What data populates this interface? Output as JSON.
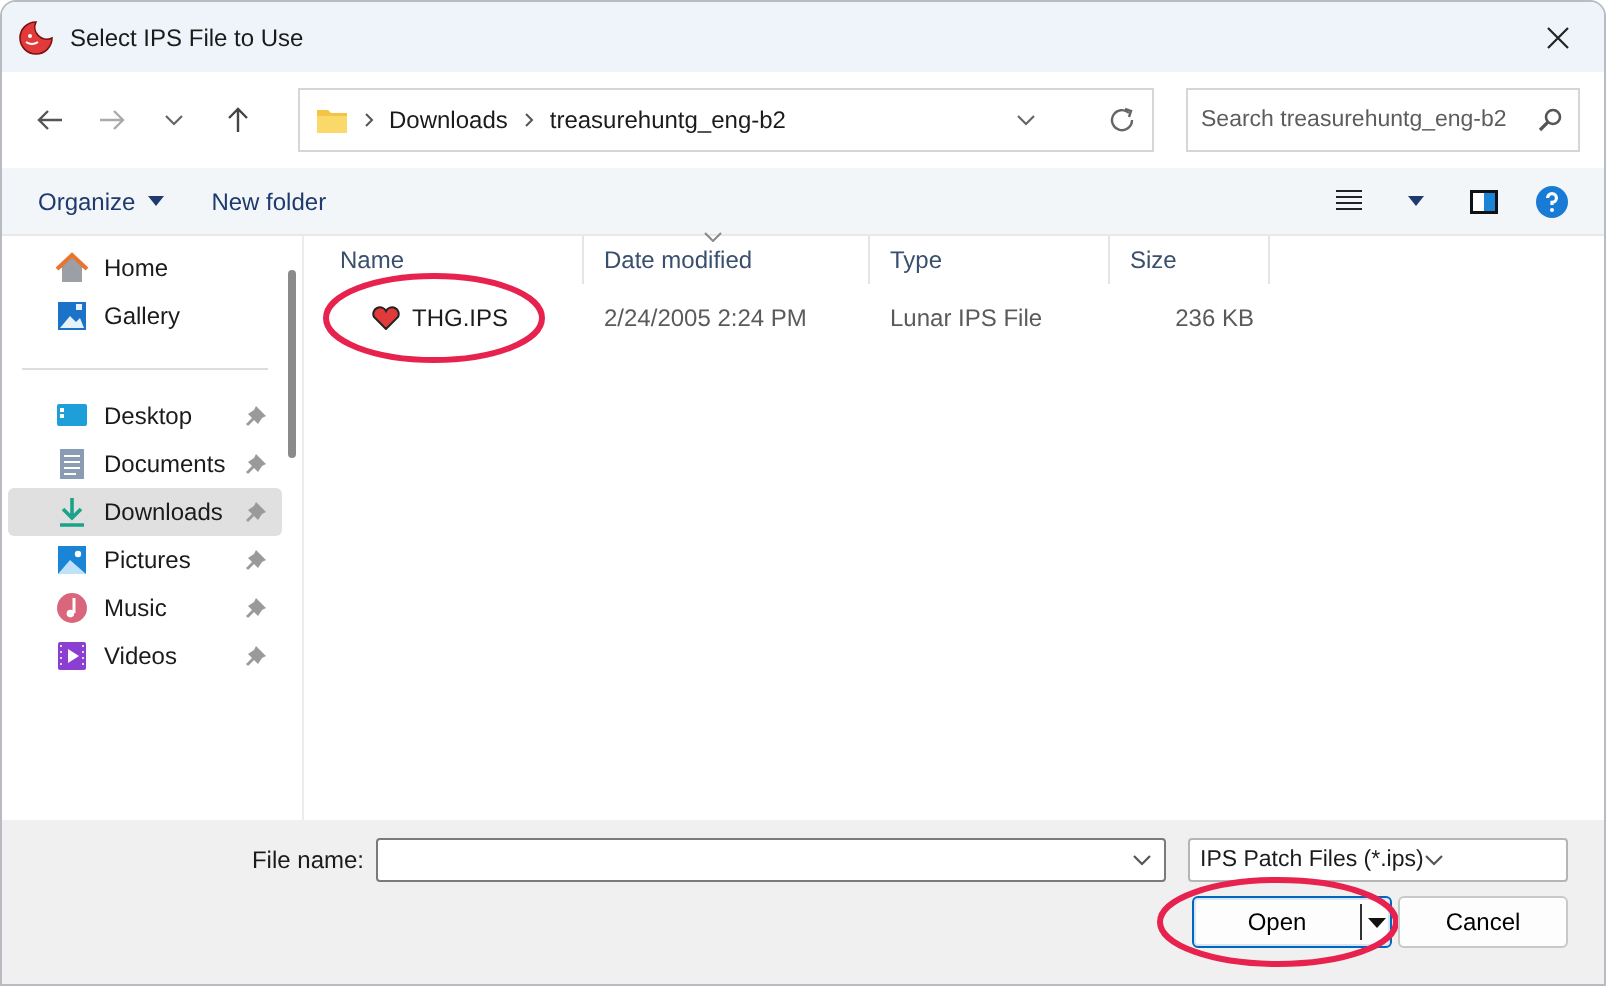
{
  "window": {
    "title": "Select IPS File to Use"
  },
  "address": {
    "segments": [
      "Downloads",
      "treasurehuntg_eng-b2"
    ]
  },
  "search": {
    "placeholder": "Search treasurehuntg_eng-b2"
  },
  "toolbar": {
    "organize": "Organize",
    "new_folder": "New folder"
  },
  "sidebar": {
    "groups": [
      [
        {
          "label": "Home",
          "selected": false,
          "pinned": false
        },
        {
          "label": "Gallery",
          "selected": false,
          "pinned": false
        }
      ],
      [
        {
          "label": "Desktop",
          "selected": false,
          "pinned": true
        },
        {
          "label": "Documents",
          "selected": false,
          "pinned": true
        },
        {
          "label": "Downloads",
          "selected": true,
          "pinned": true
        },
        {
          "label": "Pictures",
          "selected": false,
          "pinned": true
        },
        {
          "label": "Music",
          "selected": false,
          "pinned": true
        },
        {
          "label": "Videos",
          "selected": false,
          "pinned": true
        }
      ]
    ]
  },
  "table": {
    "columns": [
      {
        "label": "Name",
        "sorted": false
      },
      {
        "label": "Date modified",
        "sorted": true
      },
      {
        "label": "Type",
        "sorted": false
      },
      {
        "label": "Size",
        "sorted": false
      }
    ],
    "rows": [
      {
        "name": "THG.IPS",
        "date": "2/24/2005 2:24 PM",
        "type": "Lunar IPS File",
        "size": "236 KB",
        "circled": true
      }
    ]
  },
  "footer": {
    "file_name_label": "File name:",
    "filter": "IPS Patch Files (*.ips)",
    "buttons": [
      {
        "label": "Open",
        "kind": "split",
        "circled": true
      },
      {
        "label": "Cancel",
        "kind": "plain",
        "circled": false
      }
    ]
  }
}
